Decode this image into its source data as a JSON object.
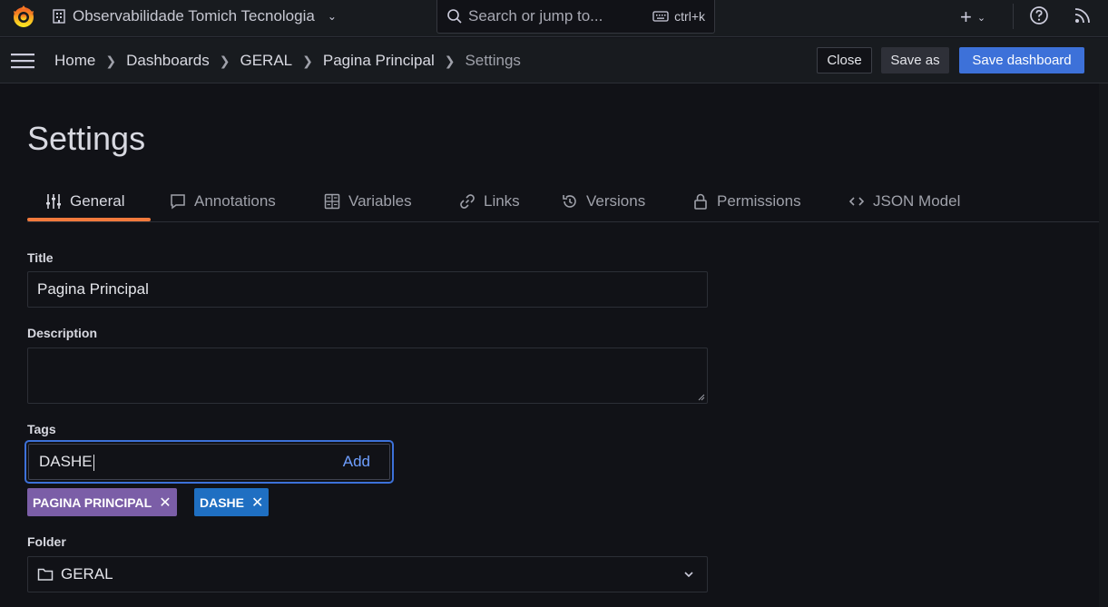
{
  "topbar": {
    "org_name": "Observabilidade Tomich Tecnologia",
    "search_placeholder": "Search or jump to...",
    "search_shortcut": "ctrl+k",
    "icons": [
      "grafana-logo-icon",
      "building-icon",
      "chevron-down-icon",
      "search-icon",
      "keyboard-icon",
      "plus-icon",
      "help-icon",
      "rss-icon"
    ]
  },
  "breadcrumb": {
    "items": [
      "Home",
      "Dashboards",
      "GERAL",
      "Pagina Principal"
    ],
    "current": "Settings"
  },
  "toolbar": {
    "close_label": "Close",
    "save_as_label": "Save as",
    "save_dashboard_label": "Save dashboard"
  },
  "settings": {
    "title": "Settings",
    "tabs": [
      {
        "label": "General",
        "icon": "sliders-icon",
        "active": true
      },
      {
        "label": "Annotations",
        "icon": "comment-icon",
        "active": false
      },
      {
        "label": "Variables",
        "icon": "calculator-icon",
        "active": false
      },
      {
        "label": "Links",
        "icon": "link-icon",
        "active": false
      },
      {
        "label": "Versions",
        "icon": "history-icon",
        "active": false
      },
      {
        "label": "Permissions",
        "icon": "lock-icon",
        "active": false
      },
      {
        "label": "JSON Model",
        "icon": "code-icon",
        "active": false
      }
    ],
    "fields": {
      "title_label": "Title",
      "title_value": "Pagina Principal",
      "description_label": "Description",
      "description_value": "",
      "tags_label": "Tags",
      "tags_input_value": "DASHE",
      "tags_add_label": "Add",
      "tags": [
        {
          "label": "PAGINA PRINCIPAL",
          "color": "#7b5ea7"
        },
        {
          "label": "DASHE",
          "color": "#1f6fc2"
        }
      ],
      "folder_label": "Folder",
      "folder_value": "GERAL"
    }
  },
  "colors": {
    "accent": "#3d71d9",
    "tab_active_underline": "#f27a3d",
    "background": "#111217"
  }
}
